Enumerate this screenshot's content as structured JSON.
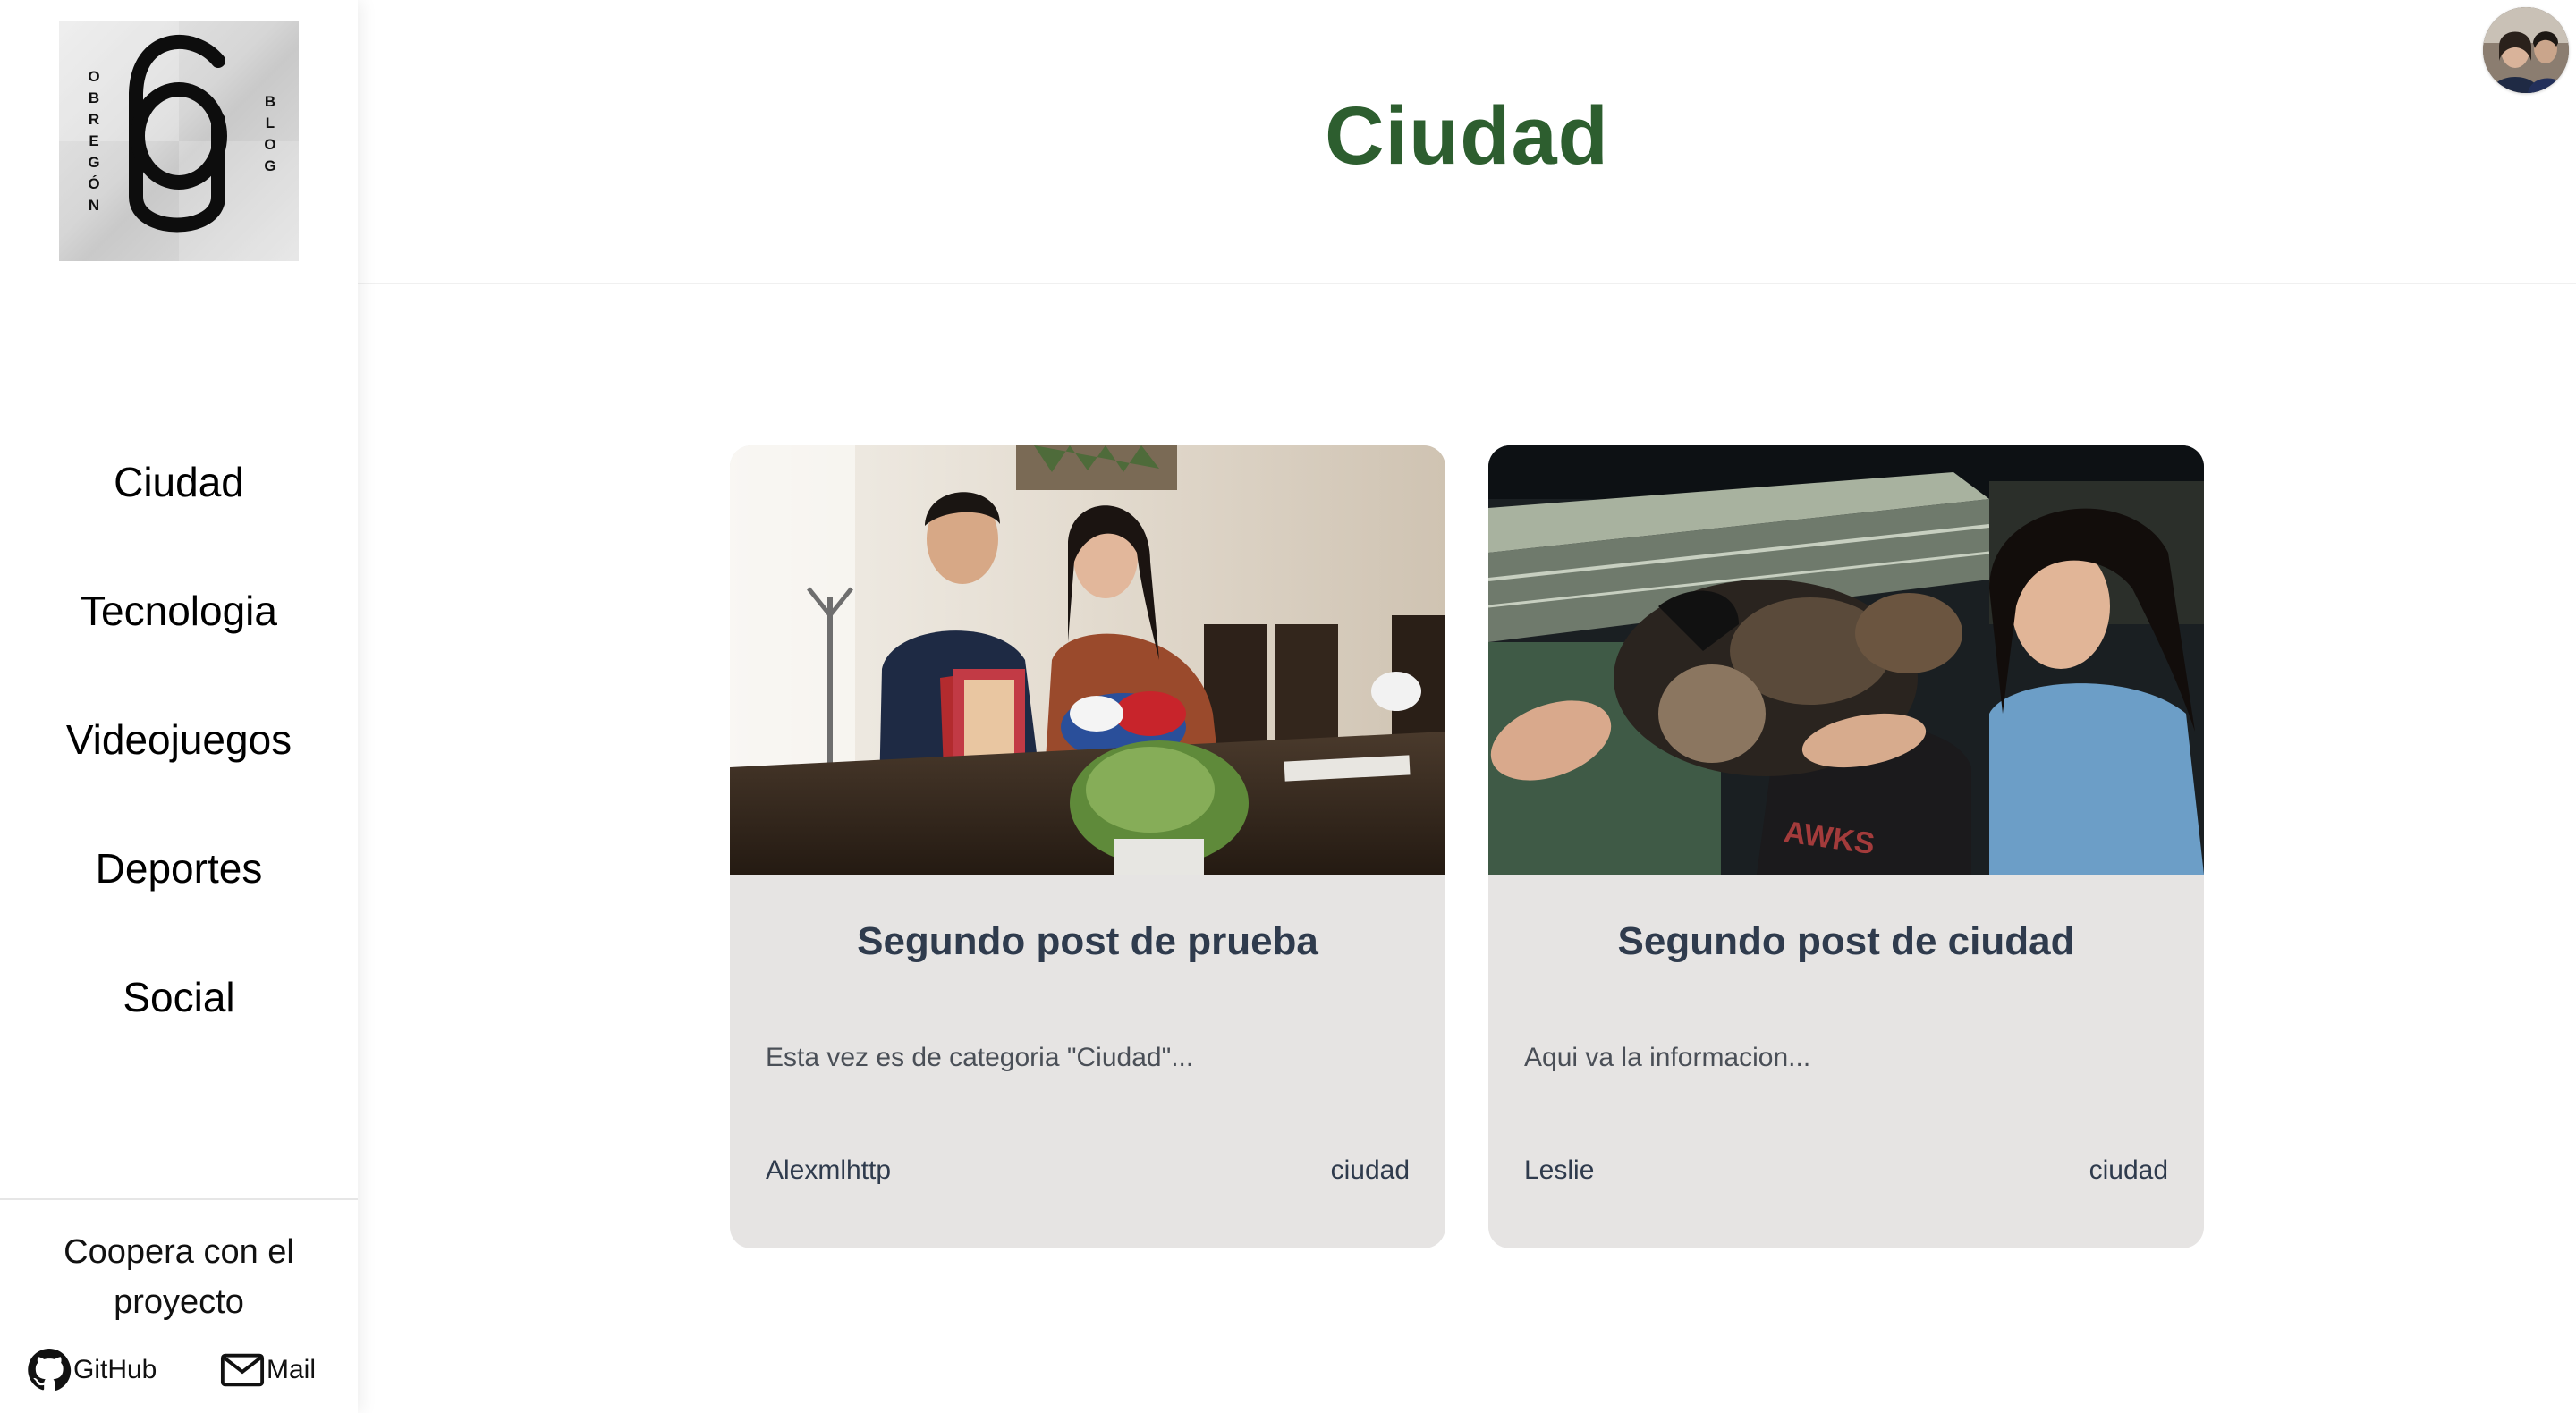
{
  "logo": {
    "left_text": "OBREGÓN",
    "right_text": "BLOG"
  },
  "nav": {
    "items": [
      {
        "label": "Ciudad"
      },
      {
        "label": "Tecnologia"
      },
      {
        "label": "Videojuegos"
      },
      {
        "label": "Deportes"
      },
      {
        "label": "Social"
      }
    ]
  },
  "footer": {
    "coop_text": "Coopera con el proyecto",
    "github_label": "GitHub",
    "mail_label": "Mail"
  },
  "header": {
    "title": "Ciudad"
  },
  "posts": [
    {
      "title": "Segundo post de prueba",
      "excerpt": "Esta vez es de categoria \"Ciudad\"...",
      "author": "Alexmlhttp",
      "category": "ciudad"
    },
    {
      "title": "Segundo post de ciudad",
      "excerpt": "Aqui va la informacion...",
      "author": "Leslie",
      "category": "ciudad"
    }
  ],
  "colors": {
    "title_green": "#2d5e2f",
    "card_bg": "#e6e4e3",
    "card_text": "#2f3b4d"
  }
}
